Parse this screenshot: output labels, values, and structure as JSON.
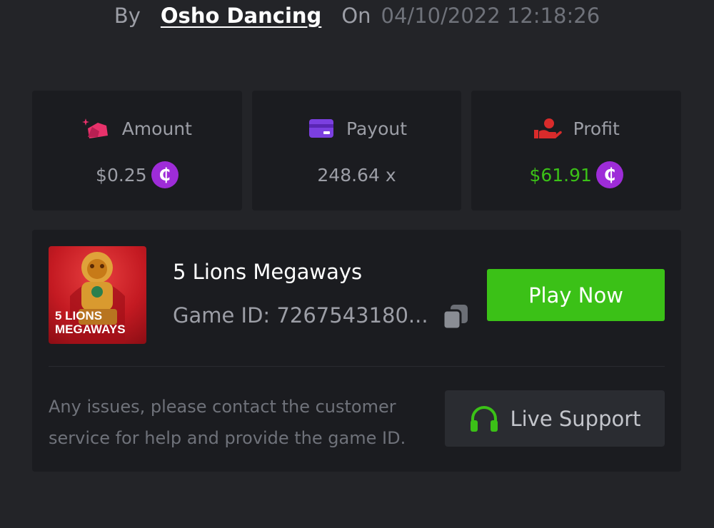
{
  "header": {
    "by_label": "By",
    "username": "Osho Dancing",
    "on_label": "On",
    "datetime": "04/10/2022 12:18:26"
  },
  "stats": [
    {
      "label": "Amount",
      "value": "$0.25",
      "icon": "money-bag-icon",
      "icon_color": "#e8326b",
      "has_coin": true,
      "value_color": "#9c9ea6"
    },
    {
      "label": "Payout",
      "value": "248.64 x",
      "icon": "credit-card-icon",
      "icon_color": "#7b3fe0",
      "has_coin": false,
      "value_color": "#9c9ea6"
    },
    {
      "label": "Profit",
      "value": "$61.91",
      "icon": "hand-profit-icon",
      "icon_color": "#d92b2b",
      "has_coin": true,
      "value_color": "#3bc117"
    }
  ],
  "coin_symbol": "₵",
  "game": {
    "thumbnail_text_line1": "5 LIONS",
    "thumbnail_text_line2": "MEGAWAYS",
    "name": "5 Lions Megaways",
    "id_text": "Game ID: 7267543180...",
    "play_label": "Play Now"
  },
  "support": {
    "message": "Any issues, please contact the customer service for help and provide the game ID.",
    "button_label": "Live Support"
  },
  "colors": {
    "background": "#232428",
    "card": "#1b1c20",
    "accent_green": "#3bc117",
    "coin_purple": "#9e2cd8"
  }
}
